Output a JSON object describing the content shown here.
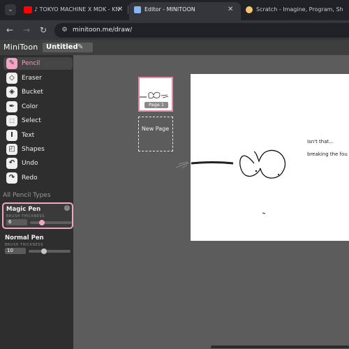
{
  "browser": {
    "tabs": [
      {
        "title": "♪ TOKYO MACHINE X MDK - KN",
        "active": false,
        "close": "✕"
      },
      {
        "title": "Editor - MINITOON",
        "active": true,
        "close": "✕"
      },
      {
        "title": "Scratch - Imagine, Program, Sh",
        "active": false
      }
    ],
    "url": "minitoon.me/draw/"
  },
  "app": {
    "brand": "MiniToon",
    "document_title": "Untitled",
    "tools": [
      {
        "label": "Pencil",
        "icon": "pencil-icon",
        "active": true
      },
      {
        "label": "Eraser",
        "icon": "eraser-icon",
        "active": false
      },
      {
        "label": "Bucket",
        "icon": "bucket-icon",
        "active": false
      },
      {
        "label": "Color",
        "icon": "color-picker-icon",
        "active": false
      },
      {
        "label": "Select",
        "icon": "select-icon",
        "active": false
      },
      {
        "label": "Text",
        "icon": "text-icon",
        "active": false
      },
      {
        "label": "Shapes",
        "icon": "shapes-icon",
        "active": false
      },
      {
        "label": "Undo",
        "icon": "undo-icon",
        "active": false
      },
      {
        "label": "Redo",
        "icon": "redo-icon",
        "active": false
      }
    ],
    "pencil_types_title": "All Pencil Types",
    "pencil_types": [
      {
        "name": "Magic Pen",
        "sub": "BRUSH THICKNESS",
        "value": "6",
        "level": 0.25,
        "selected": true
      },
      {
        "name": "Normal Pen",
        "sub": "BRUSH THICKNESS",
        "value": "10",
        "level": 0.35,
        "selected": false
      }
    ],
    "pages": {
      "thumb_label": "Page 1",
      "new_page_label": "New Page"
    },
    "canvas_texts": [
      "Isn't that...",
      "breaking the fou"
    ]
  },
  "colors": {
    "accent": "#f2a5c6",
    "thumb_border": "#e38aa6",
    "sidebar_bg": "#2e2e2e",
    "workspace_bg": "#5c5c5c"
  }
}
